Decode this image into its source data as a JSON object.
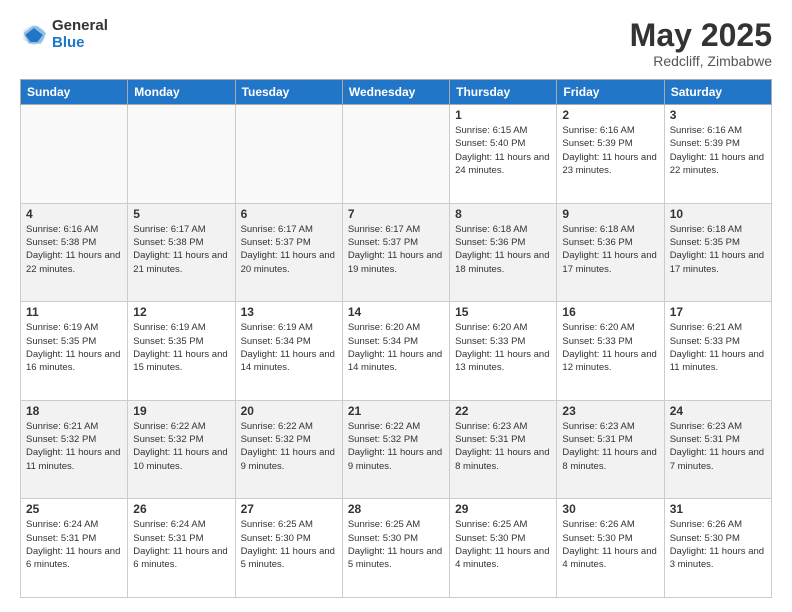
{
  "header": {
    "logo": {
      "general": "General",
      "blue": "Blue"
    },
    "title": "May 2025",
    "location": "Redcliff, Zimbabwe"
  },
  "calendar": {
    "days_of_week": [
      "Sunday",
      "Monday",
      "Tuesday",
      "Wednesday",
      "Thursday",
      "Friday",
      "Saturday"
    ],
    "weeks": [
      [
        {
          "day": "",
          "info": ""
        },
        {
          "day": "",
          "info": ""
        },
        {
          "day": "",
          "info": ""
        },
        {
          "day": "",
          "info": ""
        },
        {
          "day": "1",
          "info": "Sunrise: 6:15 AM\nSunset: 5:40 PM\nDaylight: 11 hours and 24 minutes."
        },
        {
          "day": "2",
          "info": "Sunrise: 6:16 AM\nSunset: 5:39 PM\nDaylight: 11 hours and 23 minutes."
        },
        {
          "day": "3",
          "info": "Sunrise: 6:16 AM\nSunset: 5:39 PM\nDaylight: 11 hours and 22 minutes."
        }
      ],
      [
        {
          "day": "4",
          "info": "Sunrise: 6:16 AM\nSunset: 5:38 PM\nDaylight: 11 hours and 22 minutes."
        },
        {
          "day": "5",
          "info": "Sunrise: 6:17 AM\nSunset: 5:38 PM\nDaylight: 11 hours and 21 minutes."
        },
        {
          "day": "6",
          "info": "Sunrise: 6:17 AM\nSunset: 5:37 PM\nDaylight: 11 hours and 20 minutes."
        },
        {
          "day": "7",
          "info": "Sunrise: 6:17 AM\nSunset: 5:37 PM\nDaylight: 11 hours and 19 minutes."
        },
        {
          "day": "8",
          "info": "Sunrise: 6:18 AM\nSunset: 5:36 PM\nDaylight: 11 hours and 18 minutes."
        },
        {
          "day": "9",
          "info": "Sunrise: 6:18 AM\nSunset: 5:36 PM\nDaylight: 11 hours and 17 minutes."
        },
        {
          "day": "10",
          "info": "Sunrise: 6:18 AM\nSunset: 5:35 PM\nDaylight: 11 hours and 17 minutes."
        }
      ],
      [
        {
          "day": "11",
          "info": "Sunrise: 6:19 AM\nSunset: 5:35 PM\nDaylight: 11 hours and 16 minutes."
        },
        {
          "day": "12",
          "info": "Sunrise: 6:19 AM\nSunset: 5:35 PM\nDaylight: 11 hours and 15 minutes."
        },
        {
          "day": "13",
          "info": "Sunrise: 6:19 AM\nSunset: 5:34 PM\nDaylight: 11 hours and 14 minutes."
        },
        {
          "day": "14",
          "info": "Sunrise: 6:20 AM\nSunset: 5:34 PM\nDaylight: 11 hours and 14 minutes."
        },
        {
          "day": "15",
          "info": "Sunrise: 6:20 AM\nSunset: 5:33 PM\nDaylight: 11 hours and 13 minutes."
        },
        {
          "day": "16",
          "info": "Sunrise: 6:20 AM\nSunset: 5:33 PM\nDaylight: 11 hours and 12 minutes."
        },
        {
          "day": "17",
          "info": "Sunrise: 6:21 AM\nSunset: 5:33 PM\nDaylight: 11 hours and 11 minutes."
        }
      ],
      [
        {
          "day": "18",
          "info": "Sunrise: 6:21 AM\nSunset: 5:32 PM\nDaylight: 11 hours and 11 minutes."
        },
        {
          "day": "19",
          "info": "Sunrise: 6:22 AM\nSunset: 5:32 PM\nDaylight: 11 hours and 10 minutes."
        },
        {
          "day": "20",
          "info": "Sunrise: 6:22 AM\nSunset: 5:32 PM\nDaylight: 11 hours and 9 minutes."
        },
        {
          "day": "21",
          "info": "Sunrise: 6:22 AM\nSunset: 5:32 PM\nDaylight: 11 hours and 9 minutes."
        },
        {
          "day": "22",
          "info": "Sunrise: 6:23 AM\nSunset: 5:31 PM\nDaylight: 11 hours and 8 minutes."
        },
        {
          "day": "23",
          "info": "Sunrise: 6:23 AM\nSunset: 5:31 PM\nDaylight: 11 hours and 8 minutes."
        },
        {
          "day": "24",
          "info": "Sunrise: 6:23 AM\nSunset: 5:31 PM\nDaylight: 11 hours and 7 minutes."
        }
      ],
      [
        {
          "day": "25",
          "info": "Sunrise: 6:24 AM\nSunset: 5:31 PM\nDaylight: 11 hours and 6 minutes."
        },
        {
          "day": "26",
          "info": "Sunrise: 6:24 AM\nSunset: 5:31 PM\nDaylight: 11 hours and 6 minutes."
        },
        {
          "day": "27",
          "info": "Sunrise: 6:25 AM\nSunset: 5:30 PM\nDaylight: 11 hours and 5 minutes."
        },
        {
          "day": "28",
          "info": "Sunrise: 6:25 AM\nSunset: 5:30 PM\nDaylight: 11 hours and 5 minutes."
        },
        {
          "day": "29",
          "info": "Sunrise: 6:25 AM\nSunset: 5:30 PM\nDaylight: 11 hours and 4 minutes."
        },
        {
          "day": "30",
          "info": "Sunrise: 6:26 AM\nSunset: 5:30 PM\nDaylight: 11 hours and 4 minutes."
        },
        {
          "day": "31",
          "info": "Sunrise: 6:26 AM\nSunset: 5:30 PM\nDaylight: 11 hours and 3 minutes."
        }
      ]
    ]
  }
}
